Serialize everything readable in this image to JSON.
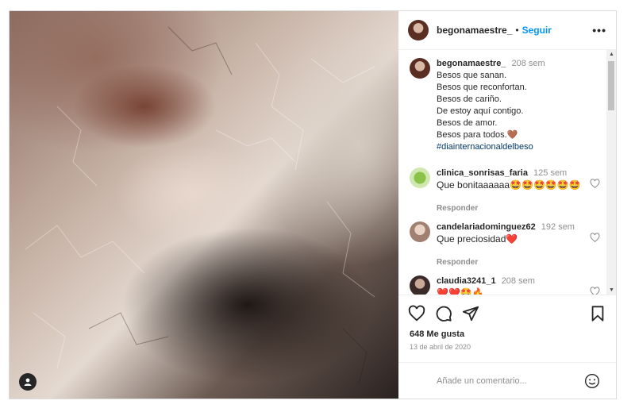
{
  "post": {
    "username": "begonamaestre_",
    "separator": "•",
    "follow_label": "Seguir",
    "more_icon": "more-horizontal-icon"
  },
  "caption": {
    "username": "begonamaestre_",
    "time": "208 sem",
    "lines": [
      "Besos que sanan.",
      "Besos que reconfortan.",
      "Besos de cariño.",
      "De estoy aquí contigo.",
      "Besos de amor.",
      "Besos para todos.🤎"
    ],
    "hashtag": "#diainternacionaldelbeso"
  },
  "comments": [
    {
      "username": "clinica_sonrisas_faria",
      "time": "125 sem",
      "text": "Que bonitaaaaaa🤩🤩🤩🤩🤩🤩",
      "reply": "Responder"
    },
    {
      "username": "candelariadominguez62",
      "time": "192 sem",
      "text": "Que preciosidad❤️",
      "reply": "Responder"
    },
    {
      "username": "claudia3241_1",
      "time": "208 sem",
      "text": "❤️❤️🤩🔥",
      "reply": ""
    }
  ],
  "likes": "648 Me gusta",
  "date": "13 de abril de 2020",
  "add_comment_placeholder": "Añade un comentario...",
  "colors": {
    "link": "#0095f6",
    "text": "#262626",
    "muted": "#8e8e8e",
    "hashtag": "#00376b"
  }
}
